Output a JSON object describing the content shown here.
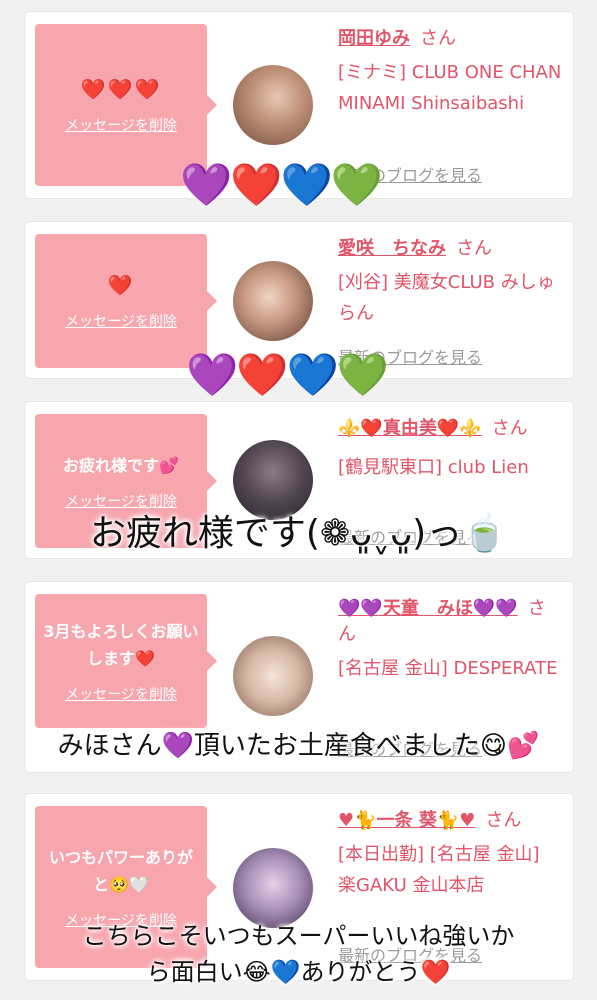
{
  "colors": {
    "pink_bubble": "#f7a6ae",
    "accent": "#e0556a",
    "card": "#ffffff",
    "bg": "#f1f1f2"
  },
  "cards": [
    {
      "message": "❤️❤️❤️",
      "delete": "メッセージを削除",
      "name": "岡田ゆみ",
      "san": "さん",
      "shop": "[ミナミ] CLUB ONE CHAN MINAMI Shinsaibashi",
      "blog": "最新のブログを見る"
    },
    {
      "message": "❤️",
      "delete": "メッセージを削除",
      "name": "愛咲　ちなみ",
      "san": "さん",
      "shop": "[刈谷] 美魔女CLUB みしゅらん",
      "blog": "最新のブログを見る"
    },
    {
      "message": "お疲れ様です💕",
      "delete": "メッセージを削除",
      "name": "⚜️❤️真由美❤️⚜️",
      "san": "さん",
      "shop": "[鶴見駅東口] club Lien",
      "blog": "最新のブログを見る"
    },
    {
      "message": "3月もよろしくお願いします❤️",
      "delete": "メッセージを削除",
      "name": "💜💜天童　みほ💜💜",
      "san": "さん",
      "shop": "[名古屋 金山] DESPERATE",
      "blog": "最新のブログを見る"
    },
    {
      "message": "いつもパワーありがと🥺🤍",
      "delete": "メッセージを削除",
      "name": "♥🐈一条 葵🐈♥",
      "san": "さん",
      "shop": "[本日出勤] [名古屋 金山] 楽GAKU 金山本店",
      "blog": "最新のブログを見る"
    }
  ],
  "overlays": {
    "hearts_row_1": "💜❤️💙💚",
    "hearts_row_2": "💜❤️💙💚",
    "caption_1": "お疲れ様です(❁ᴗ͈ˬᴗ͈)っ🍵",
    "caption_2": "みほさん💜頂いたお土産食べました😋💕",
    "caption_3_line1": "こちらこそいつもスーパーいいね強いか",
    "caption_3_line2": "ら面白い😂💙ありがとう❤️"
  }
}
